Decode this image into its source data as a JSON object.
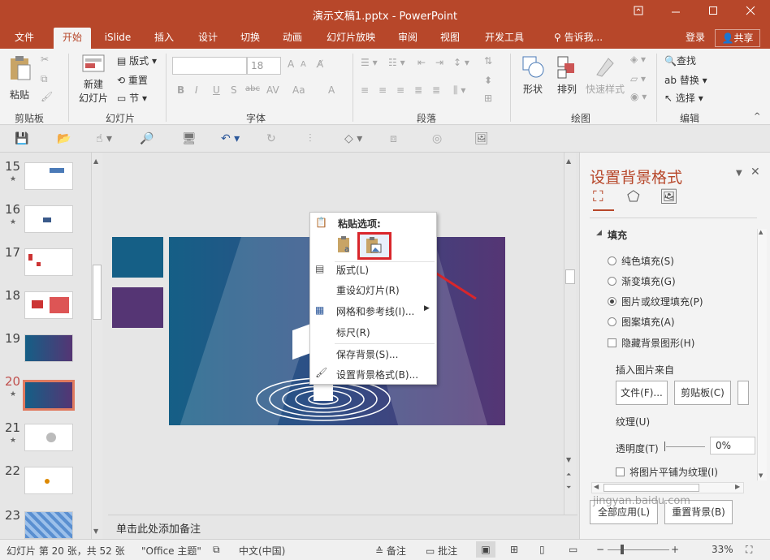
{
  "window": {
    "title": "演示文稿1.pptx - PowerPoint"
  },
  "tabs": [
    "文件",
    "开始",
    "iSlide",
    "插入",
    "设计",
    "切换",
    "动画",
    "幻灯片放映",
    "审阅",
    "视图",
    "开发工具"
  ],
  "active_tab": "开始",
  "tell_me": "告诉我...",
  "login": "登录",
  "share": "共享",
  "ribbon": {
    "clipboard": {
      "paste": "粘贴",
      "label": "剪贴板"
    },
    "slides": {
      "new_line1": "新建",
      "new_line2": "幻灯片",
      "layout": "版式",
      "reset": "重置",
      "section": "节",
      "label": "幻灯片"
    },
    "font": {
      "size": "18",
      "bold": "B",
      "italic": "I",
      "underline": "U",
      "shadow": "S",
      "strike": "abc",
      "spacing": "AV",
      "case": "Aa",
      "grow": "A",
      "shrink": "A",
      "color": "A",
      "label": "字体"
    },
    "paragraph": {
      "label": "段落"
    },
    "drawing": {
      "shapes": "形状",
      "arrange": "排列",
      "quick_styles": "快速样式",
      "label": "绘图"
    },
    "editing": {
      "find": "查找",
      "replace": "替换",
      "select": "选择",
      "label": "编辑"
    }
  },
  "thumbnails": [
    {
      "num": "15",
      "star": "★"
    },
    {
      "num": "16",
      "star": "★"
    },
    {
      "num": "17",
      "star": ""
    },
    {
      "num": "18",
      "star": ""
    },
    {
      "num": "19",
      "star": ""
    },
    {
      "num": "20",
      "star": "★"
    },
    {
      "num": "21",
      "star": "★"
    },
    {
      "num": "22",
      "star": ""
    },
    {
      "num": "23",
      "star": ""
    }
  ],
  "context_menu": {
    "header": "粘贴选项:",
    "items": [
      "版式(L)",
      "重设幻灯片(R)",
      "网格和参考线(I)...",
      "标尺(R)",
      "保存背景(S)...",
      "设置背景格式(B)..."
    ]
  },
  "notes_placeholder": "单击此处添加备注",
  "pane": {
    "title": "设置背景格式",
    "fill_section": "填充",
    "options": [
      "纯色填充(S)",
      "渐变填充(G)",
      "图片或纹理填充(P)",
      "图案填充(A)"
    ],
    "selected_option": "图片或纹理填充(P)",
    "hide_bg": "隐藏背景图形(H)",
    "insert_from": "插入图片来自",
    "file_btn": "文件(F)...",
    "clipboard_btn": "剪贴板(C)",
    "texture": "纹理(U)",
    "transparency_label": "透明度(T)",
    "transparency_value": "0%",
    "tile": "将图片平铺为纹理(I)",
    "apply_all": "全部应用(L)",
    "reset_bg": "重置背景(B)"
  },
  "status": {
    "slide_info": "幻灯片 第 20 张，共 52 张",
    "theme": "\"Office 主题\"",
    "language": "中文(中国)",
    "notes": "备注",
    "comments": "批注",
    "zoom": "33%"
  },
  "watermark": "jingyan.baidu.com",
  "colors": {
    "accent": "#b7472a",
    "selected_thumb": "#e07a5f",
    "slide_left": "#155f86",
    "slide_right": "#553574",
    "arrow": "#d9262b"
  }
}
